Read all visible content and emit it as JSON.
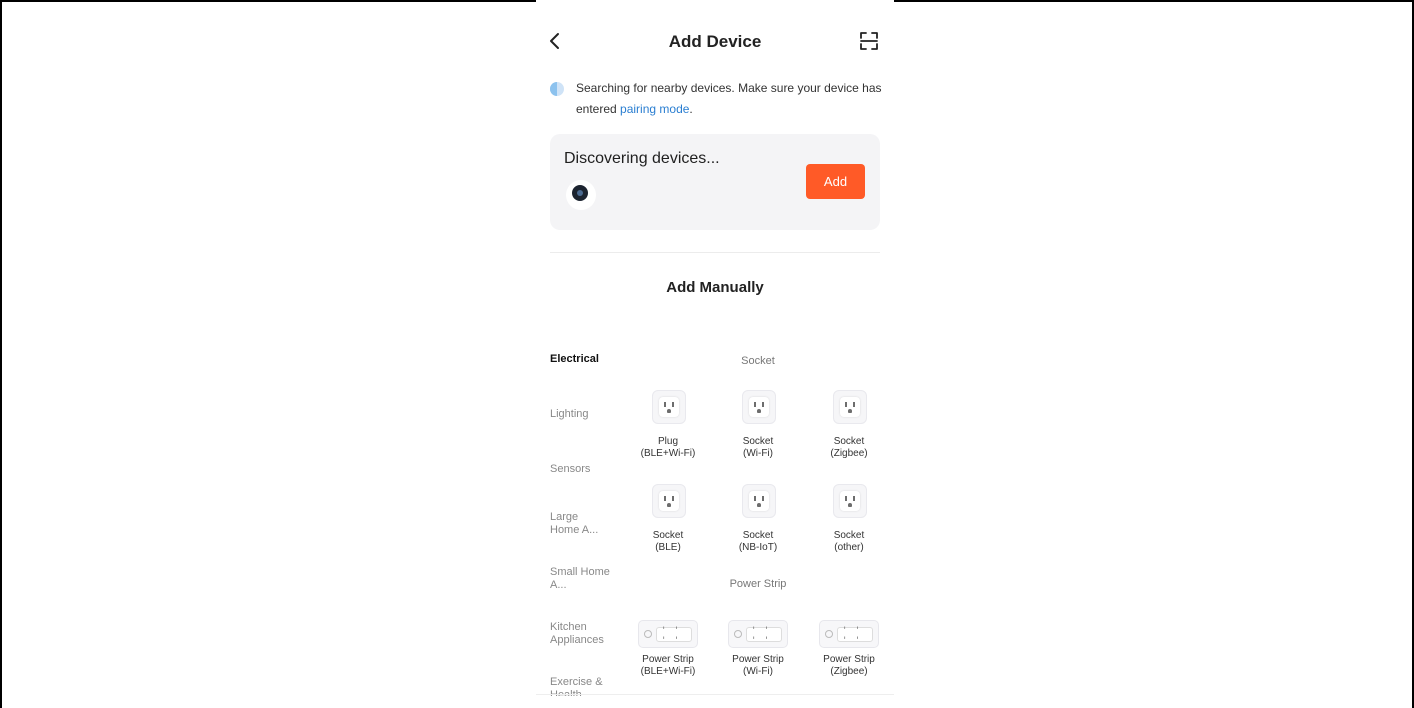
{
  "header": {
    "title": "Add Device",
    "back_icon": "chevron-left-icon",
    "scan_icon": "scan-qr-icon"
  },
  "search": {
    "text": "Searching for nearby devices. Make sure your device has entered ",
    "link": "pairing mode",
    "suffix": "."
  },
  "discover": {
    "title": "Discovering devices...",
    "add_label": "Add",
    "add_color": "#ff5a27",
    "device_icon": "camera-icon"
  },
  "manual": {
    "title": "Add Manually"
  },
  "categories": [
    {
      "label": "Electrical",
      "active": true
    },
    {
      "label": "Lighting"
    },
    {
      "label": "Sensors"
    },
    {
      "label": "Large Home A..."
    },
    {
      "label": "Small Home A..."
    },
    {
      "label": "Kitchen Appliances"
    },
    {
      "label": "Exercise & Health"
    }
  ],
  "sections": {
    "socket": "Socket",
    "power_strip": "Power Strip"
  },
  "socket_tiles": [
    {
      "line1": "Plug",
      "line2": "(BLE+Wi-Fi)"
    },
    {
      "line1": "Socket",
      "line2": "(Wi-Fi)"
    },
    {
      "line1": "Socket",
      "line2": "(Zigbee)"
    },
    {
      "line1": "Socket",
      "line2": "(BLE)"
    },
    {
      "line1": "Socket",
      "line2": "(NB-IoT)"
    },
    {
      "line1": "Socket",
      "line2": "(other)"
    }
  ],
  "strip_tiles": [
    {
      "line1": "Power Strip",
      "line2": "(BLE+Wi-Fi)"
    },
    {
      "line1": "Power Strip",
      "line2": "(Wi-Fi)"
    },
    {
      "line1": "Power Strip",
      "line2": "(Zigbee)"
    }
  ]
}
